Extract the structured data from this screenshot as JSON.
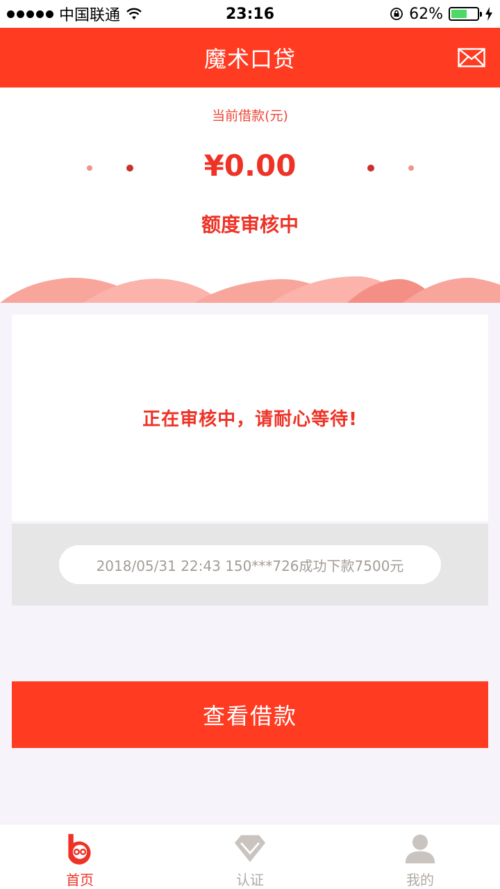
{
  "status_bar": {
    "carrier": "中国联通",
    "time": "23:16",
    "battery": "62%",
    "battery_level": 0.62
  },
  "header": {
    "title": "魔术口贷"
  },
  "summary": {
    "label": "当前借款(元)",
    "amount": "¥0.00",
    "status": "额度审核中"
  },
  "review": {
    "message": "正在审核中，请耐心等待!"
  },
  "ticker": {
    "text": "2018/05/31 22:43 150***726成功下款7500元"
  },
  "actions": {
    "view_loan": "查看借款"
  },
  "tabs": [
    {
      "label": "首页",
      "icon": "home-logo-icon",
      "active": true
    },
    {
      "label": "认证",
      "icon": "diamond-icon",
      "active": false
    },
    {
      "label": "我的",
      "icon": "user-icon",
      "active": false
    }
  ],
  "colors": {
    "accent": "#ff3b22",
    "accent_text": "#ee3226",
    "ticker_text": "#a39c96",
    "inactive_tab": "#b0aaa4"
  }
}
